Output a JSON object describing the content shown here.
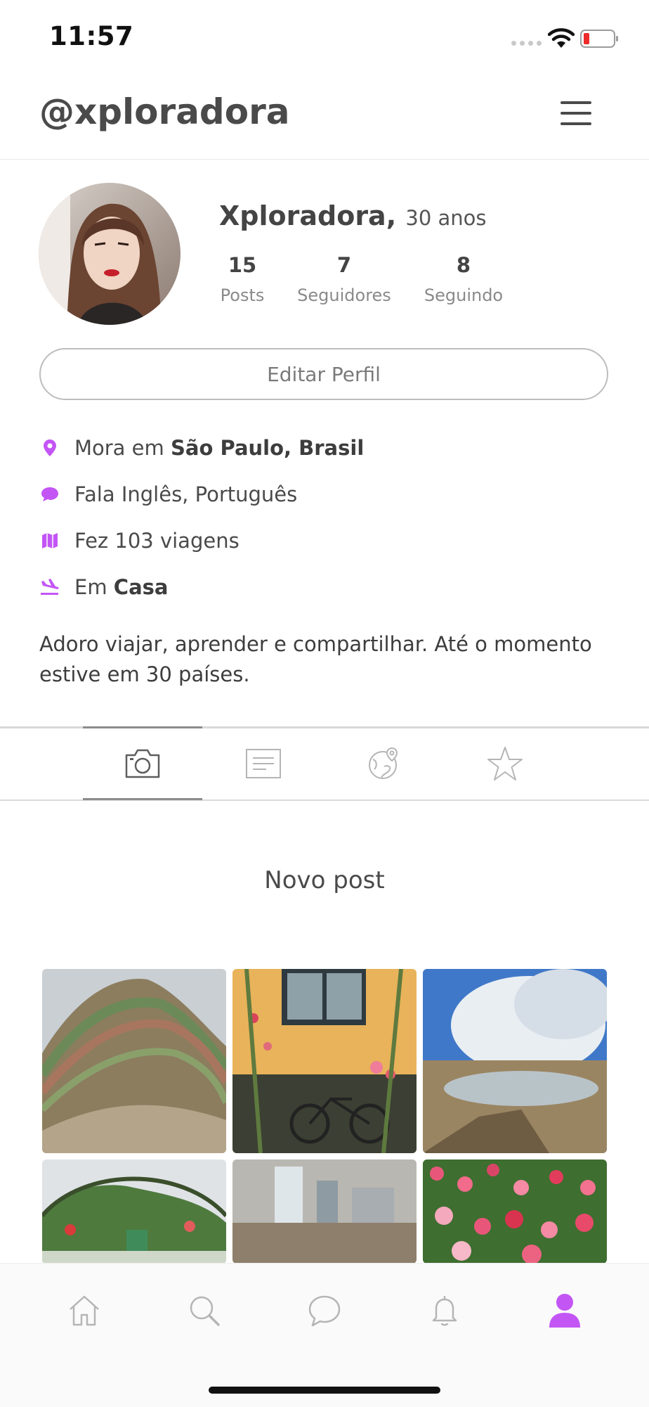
{
  "status_bar": {
    "time": "11:57"
  },
  "header": {
    "handle": "@xploradora",
    "menu_icon": "hamburger-menu-icon"
  },
  "profile": {
    "name": "Xploradora,",
    "age": "30 anos",
    "stats": [
      {
        "value": "15",
        "label": "Posts"
      },
      {
        "value": "7",
        "label": "Seguidores"
      },
      {
        "value": "8",
        "label": "Seguindo"
      }
    ],
    "edit_button": "Editar Perfil"
  },
  "info": {
    "location_prefix": "Mora em",
    "location_value": "São Paulo, Brasil",
    "languages": "Fala Inglês, Português",
    "trips": "Fez 103 viagens",
    "status_prefix": "Em",
    "status_value": "Casa"
  },
  "bio": "Adoro viajar, aprender e compartilhar. Até o momento estive em 30 países.",
  "tabs": [
    {
      "icon": "camera-icon",
      "active": true
    },
    {
      "icon": "list-icon",
      "active": false
    },
    {
      "icon": "globe-pin-icon",
      "active": false
    },
    {
      "icon": "star-icon",
      "active": false
    }
  ],
  "new_post": "Novo post",
  "bottom_nav": [
    {
      "icon": "home-icon",
      "active": false
    },
    {
      "icon": "search-icon",
      "active": false
    },
    {
      "icon": "chat-icon",
      "active": false
    },
    {
      "icon": "bell-icon",
      "active": false
    },
    {
      "icon": "profile-icon",
      "active": true
    }
  ],
  "colors": {
    "accent": "#c355f5",
    "text": "#4a4a4a",
    "muted": "#8a8a8a",
    "border": "#d9d9d9"
  }
}
